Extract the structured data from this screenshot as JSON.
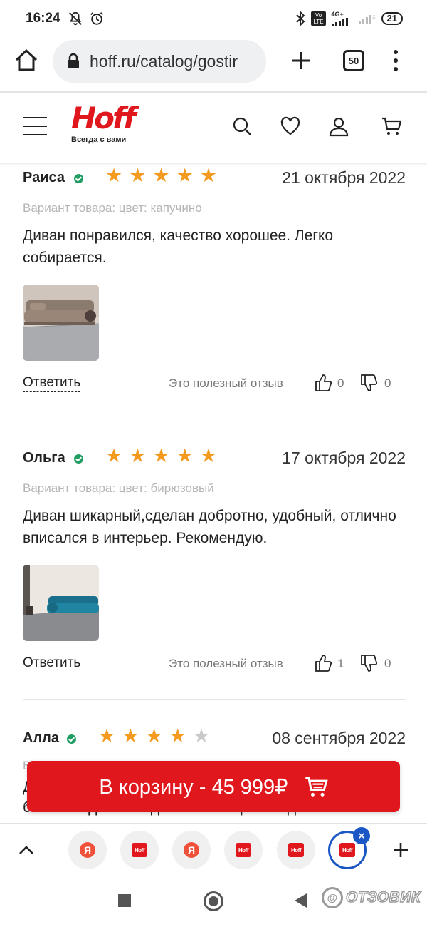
{
  "status_bar": {
    "time": "16:24",
    "battery": "21",
    "volte": "Vo LTE",
    "network": "4G+"
  },
  "browser": {
    "url": "hoff.ru/catalog/gostir",
    "tab_count": "50"
  },
  "site": {
    "logo": "Hoff",
    "tagline": "Всегда с вами",
    "brand_color": "#e1171e"
  },
  "reviews": [
    {
      "name": "Раиса",
      "rating": 5,
      "date": "21 октября 2022",
      "variant": "Вариант товара: цвет: капучино",
      "text": "Диван понравился, качество хорошее. Легко собирается.",
      "photo": "sofa-cappuccino-photo",
      "reply_label": "Ответить",
      "useful_label": "Это полезный отзыв",
      "likes": "0",
      "dislikes": "0"
    },
    {
      "name": "Ольга",
      "rating": 5,
      "date": "17 октября 2022",
      "variant": "Вариант товара: цвет: бирюзовый",
      "text": "Диван шикарный,сделан добротно, удобный, отлично вписался в интерьер. Рекомендую.",
      "photo": "sofa-turquoise-photo",
      "reply_label": "Ответить",
      "useful_label": "Это полезный отзыв",
      "likes": "1",
      "dislikes": "0"
    },
    {
      "name": "Алла",
      "rating": 4,
      "date": "08 сентября 2022",
      "variant": "В",
      "text_visible_line1": "Д",
      "text_visible_line2": "большая длина сиденья. . Но производитель"
    }
  ],
  "cart_button": {
    "label": "В корзину - 45 999₽"
  },
  "tab_strip": {
    "tabs": [
      {
        "icon": "yandex-favicon",
        "label": "Я"
      },
      {
        "icon": "hoff-favicon",
        "label": "Hoff"
      },
      {
        "icon": "yandex-favicon",
        "label": "Я"
      },
      {
        "icon": "hoff-favicon",
        "label": "Hoff"
      },
      {
        "icon": "hoff-favicon",
        "label": "Hoff"
      },
      {
        "icon": "hoff-favicon",
        "label": "Hoff",
        "active": true
      }
    ],
    "close_glyph": "×"
  },
  "watermark": {
    "text": "ОТЗОВИК",
    "badge": "@"
  }
}
